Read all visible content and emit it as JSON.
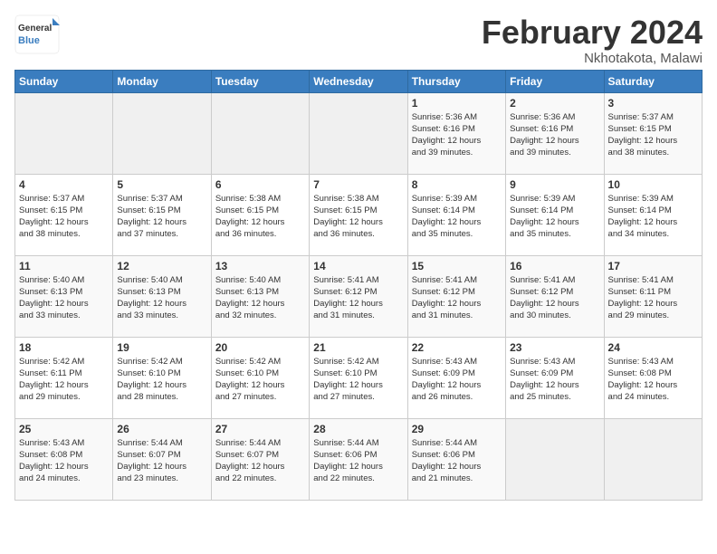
{
  "header": {
    "logo_general": "General",
    "logo_blue": "Blue",
    "month_title": "February 2024",
    "subtitle": "Nkhotakota, Malawi"
  },
  "days_of_week": [
    "Sunday",
    "Monday",
    "Tuesday",
    "Wednesday",
    "Thursday",
    "Friday",
    "Saturday"
  ],
  "weeks": [
    [
      {
        "day": "",
        "info": ""
      },
      {
        "day": "",
        "info": ""
      },
      {
        "day": "",
        "info": ""
      },
      {
        "day": "",
        "info": ""
      },
      {
        "day": "1",
        "info": "Sunrise: 5:36 AM\nSunset: 6:16 PM\nDaylight: 12 hours\nand 39 minutes."
      },
      {
        "day": "2",
        "info": "Sunrise: 5:36 AM\nSunset: 6:16 PM\nDaylight: 12 hours\nand 39 minutes."
      },
      {
        "day": "3",
        "info": "Sunrise: 5:37 AM\nSunset: 6:15 PM\nDaylight: 12 hours\nand 38 minutes."
      }
    ],
    [
      {
        "day": "4",
        "info": "Sunrise: 5:37 AM\nSunset: 6:15 PM\nDaylight: 12 hours\nand 38 minutes."
      },
      {
        "day": "5",
        "info": "Sunrise: 5:37 AM\nSunset: 6:15 PM\nDaylight: 12 hours\nand 37 minutes."
      },
      {
        "day": "6",
        "info": "Sunrise: 5:38 AM\nSunset: 6:15 PM\nDaylight: 12 hours\nand 36 minutes."
      },
      {
        "day": "7",
        "info": "Sunrise: 5:38 AM\nSunset: 6:15 PM\nDaylight: 12 hours\nand 36 minutes."
      },
      {
        "day": "8",
        "info": "Sunrise: 5:39 AM\nSunset: 6:14 PM\nDaylight: 12 hours\nand 35 minutes."
      },
      {
        "day": "9",
        "info": "Sunrise: 5:39 AM\nSunset: 6:14 PM\nDaylight: 12 hours\nand 35 minutes."
      },
      {
        "day": "10",
        "info": "Sunrise: 5:39 AM\nSunset: 6:14 PM\nDaylight: 12 hours\nand 34 minutes."
      }
    ],
    [
      {
        "day": "11",
        "info": "Sunrise: 5:40 AM\nSunset: 6:13 PM\nDaylight: 12 hours\nand 33 minutes."
      },
      {
        "day": "12",
        "info": "Sunrise: 5:40 AM\nSunset: 6:13 PM\nDaylight: 12 hours\nand 33 minutes."
      },
      {
        "day": "13",
        "info": "Sunrise: 5:40 AM\nSunset: 6:13 PM\nDaylight: 12 hours\nand 32 minutes."
      },
      {
        "day": "14",
        "info": "Sunrise: 5:41 AM\nSunset: 6:12 PM\nDaylight: 12 hours\nand 31 minutes."
      },
      {
        "day": "15",
        "info": "Sunrise: 5:41 AM\nSunset: 6:12 PM\nDaylight: 12 hours\nand 31 minutes."
      },
      {
        "day": "16",
        "info": "Sunrise: 5:41 AM\nSunset: 6:12 PM\nDaylight: 12 hours\nand 30 minutes."
      },
      {
        "day": "17",
        "info": "Sunrise: 5:41 AM\nSunset: 6:11 PM\nDaylight: 12 hours\nand 29 minutes."
      }
    ],
    [
      {
        "day": "18",
        "info": "Sunrise: 5:42 AM\nSunset: 6:11 PM\nDaylight: 12 hours\nand 29 minutes."
      },
      {
        "day": "19",
        "info": "Sunrise: 5:42 AM\nSunset: 6:10 PM\nDaylight: 12 hours\nand 28 minutes."
      },
      {
        "day": "20",
        "info": "Sunrise: 5:42 AM\nSunset: 6:10 PM\nDaylight: 12 hours\nand 27 minutes."
      },
      {
        "day": "21",
        "info": "Sunrise: 5:42 AM\nSunset: 6:10 PM\nDaylight: 12 hours\nand 27 minutes."
      },
      {
        "day": "22",
        "info": "Sunrise: 5:43 AM\nSunset: 6:09 PM\nDaylight: 12 hours\nand 26 minutes."
      },
      {
        "day": "23",
        "info": "Sunrise: 5:43 AM\nSunset: 6:09 PM\nDaylight: 12 hours\nand 25 minutes."
      },
      {
        "day": "24",
        "info": "Sunrise: 5:43 AM\nSunset: 6:08 PM\nDaylight: 12 hours\nand 24 minutes."
      }
    ],
    [
      {
        "day": "25",
        "info": "Sunrise: 5:43 AM\nSunset: 6:08 PM\nDaylight: 12 hours\nand 24 minutes."
      },
      {
        "day": "26",
        "info": "Sunrise: 5:44 AM\nSunset: 6:07 PM\nDaylight: 12 hours\nand 23 minutes."
      },
      {
        "day": "27",
        "info": "Sunrise: 5:44 AM\nSunset: 6:07 PM\nDaylight: 12 hours\nand 22 minutes."
      },
      {
        "day": "28",
        "info": "Sunrise: 5:44 AM\nSunset: 6:06 PM\nDaylight: 12 hours\nand 22 minutes."
      },
      {
        "day": "29",
        "info": "Sunrise: 5:44 AM\nSunset: 6:06 PM\nDaylight: 12 hours\nand 21 minutes."
      },
      {
        "day": "",
        "info": ""
      },
      {
        "day": "",
        "info": ""
      }
    ]
  ]
}
